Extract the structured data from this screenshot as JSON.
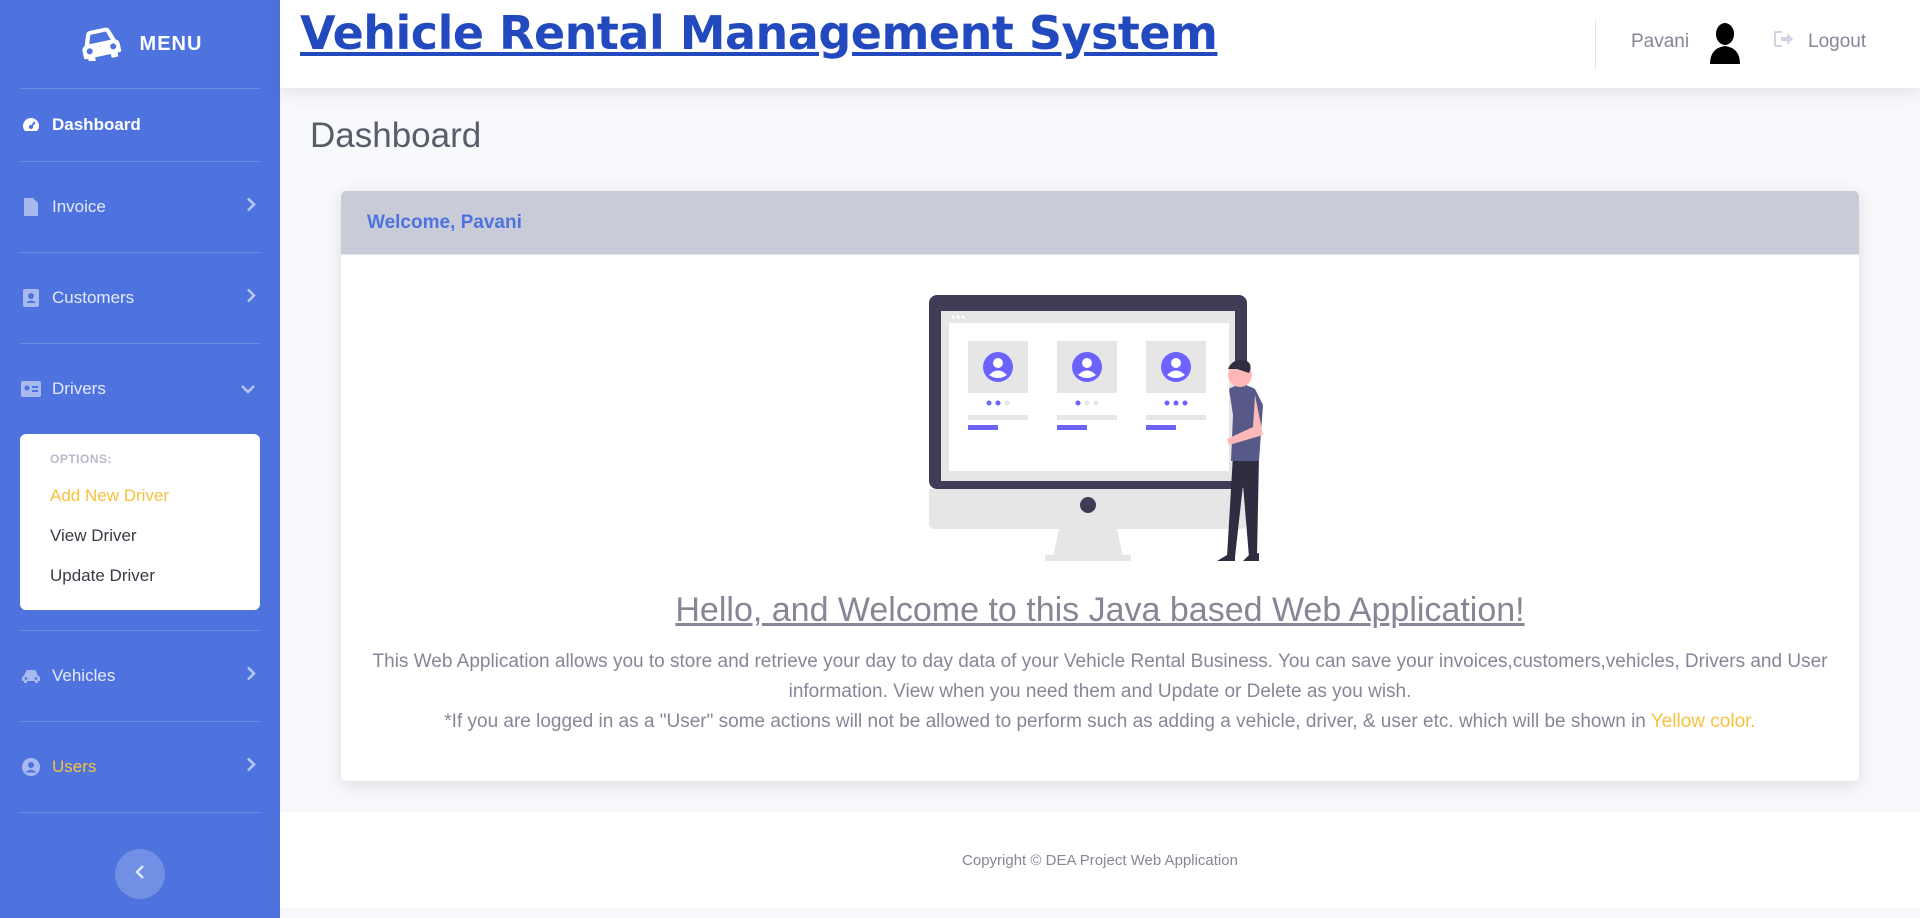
{
  "sidebar": {
    "brand_label": "MENU",
    "dashboard_label": "Dashboard",
    "items": [
      {
        "label": "Invoice"
      },
      {
        "label": "Customers"
      },
      {
        "label": "Drivers"
      },
      {
        "label": "Vehicles"
      },
      {
        "label": "Users"
      }
    ],
    "submenu": {
      "header": "OPTIONS:",
      "items": [
        {
          "label": "Add New Driver"
        },
        {
          "label": "View Driver"
        },
        {
          "label": "Update Driver"
        }
      ]
    }
  },
  "topbar": {
    "app_title": "Vehicle Rental Management System",
    "user_name": "Pavani",
    "logout_label": "Logout"
  },
  "main": {
    "page_title": "Dashboard",
    "card_header": "Welcome, Pavani",
    "hello": "Hello, and Welcome to this Java based Web Application!",
    "desc_line1": "This Web Application allows you to store and retrieve your day to day data of your Vehicle Rental Business. You can save your invoices,customers,vehicles, Drivers and User information. View when you need them and Update or Delete as you wish.",
    "desc_line2_prefix": "*If you are logged in as a \"User\" some actions will not be allowed to perform such as adding a vehicle, driver, & user etc. which will be shown in",
    "desc_line2_highlight": "Yellow color."
  },
  "footer": {
    "copyright": "Copyright © DEA Project Web Application"
  },
  "colors": {
    "primary": "#4e73df",
    "title_blue": "#224abe",
    "warning": "#f6c23e",
    "text_gray": "#858796",
    "illustration_purple": "#6c63ff"
  }
}
